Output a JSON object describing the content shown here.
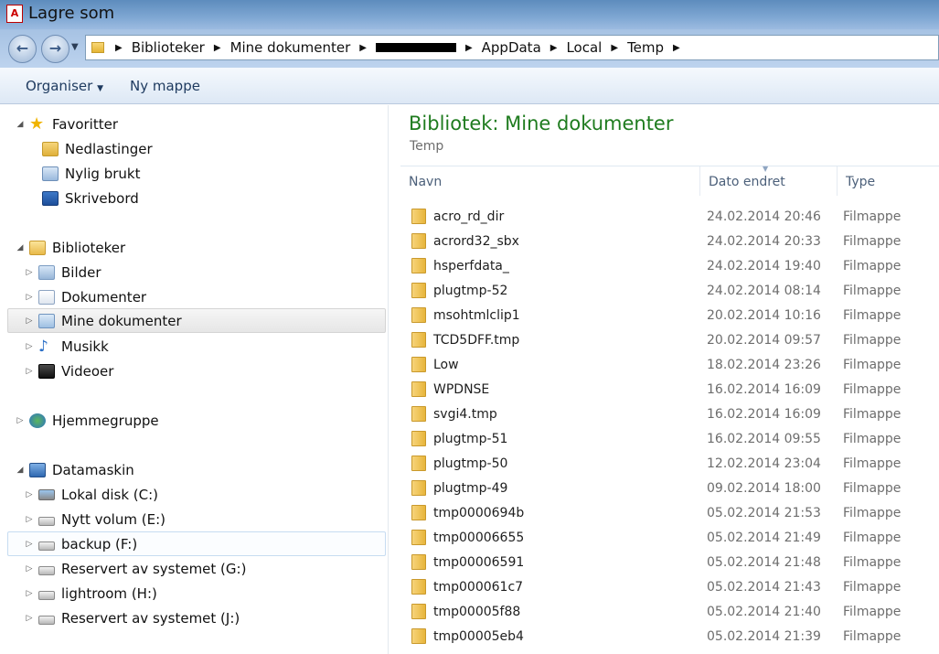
{
  "window": {
    "title": "Lagre som",
    "icon": "pdf-icon"
  },
  "address": {
    "crumbs": [
      "Biblioteker",
      "Mine dokumenter",
      "AppData",
      "Local",
      "Temp"
    ]
  },
  "toolbar": {
    "organize": "Organiser",
    "new_folder": "Ny mappe"
  },
  "nav": {
    "favorites": "Favoritter",
    "downloads": "Nedlastinger",
    "recent": "Nylig brukt",
    "desktop": "Skrivebord",
    "libraries": "Biblioteker",
    "pictures": "Bilder",
    "documents": "Dokumenter",
    "mydocs": "Mine dokumenter",
    "music": "Musikk",
    "videos": "Videoer",
    "homegroup": "Hjemmegruppe",
    "computer": "Datamaskin",
    "drive_c": "Lokal disk (C:)",
    "drive_e": "Nytt volum (E:)",
    "drive_f": "backup (F:)",
    "drive_g": "Reservert av systemet (G:)",
    "drive_h": "lightroom (H:)",
    "drive_j": "Reservert av systemet (J:)"
  },
  "content": {
    "title": "Bibliotek: Mine dokumenter",
    "subtitle": "Temp",
    "columns": {
      "name": "Navn",
      "date": "Dato endret",
      "type": "Type"
    },
    "files": [
      {
        "name": "acro_rd_dir",
        "date": "24.02.2014 20:46",
        "type": "Filmappe"
      },
      {
        "name": "acrord32_sbx",
        "date": "24.02.2014 20:33",
        "type": "Filmappe"
      },
      {
        "name": "hsperfdata_",
        "date": "24.02.2014 19:40",
        "type": "Filmappe"
      },
      {
        "name": "plugtmp-52",
        "date": "24.02.2014 08:14",
        "type": "Filmappe"
      },
      {
        "name": "msohtmlclip1",
        "date": "20.02.2014 10:16",
        "type": "Filmappe"
      },
      {
        "name": "TCD5DFF.tmp",
        "date": "20.02.2014 09:57",
        "type": "Filmappe"
      },
      {
        "name": "Low",
        "date": "18.02.2014 23:26",
        "type": "Filmappe"
      },
      {
        "name": "WPDNSE",
        "date": "16.02.2014 16:09",
        "type": "Filmappe"
      },
      {
        "name": "svgi4.tmp",
        "date": "16.02.2014 16:09",
        "type": "Filmappe"
      },
      {
        "name": "plugtmp-51",
        "date": "16.02.2014 09:55",
        "type": "Filmappe"
      },
      {
        "name": "plugtmp-50",
        "date": "12.02.2014 23:04",
        "type": "Filmappe"
      },
      {
        "name": "plugtmp-49",
        "date": "09.02.2014 18:00",
        "type": "Filmappe"
      },
      {
        "name": "tmp0000694b",
        "date": "05.02.2014 21:53",
        "type": "Filmappe"
      },
      {
        "name": "tmp00006655",
        "date": "05.02.2014 21:49",
        "type": "Filmappe"
      },
      {
        "name": "tmp00006591",
        "date": "05.02.2014 21:48",
        "type": "Filmappe"
      },
      {
        "name": "tmp000061c7",
        "date": "05.02.2014 21:43",
        "type": "Filmappe"
      },
      {
        "name": "tmp00005f88",
        "date": "05.02.2014 21:40",
        "type": "Filmappe"
      },
      {
        "name": "tmp00005eb4",
        "date": "05.02.2014 21:39",
        "type": "Filmappe"
      }
    ]
  }
}
